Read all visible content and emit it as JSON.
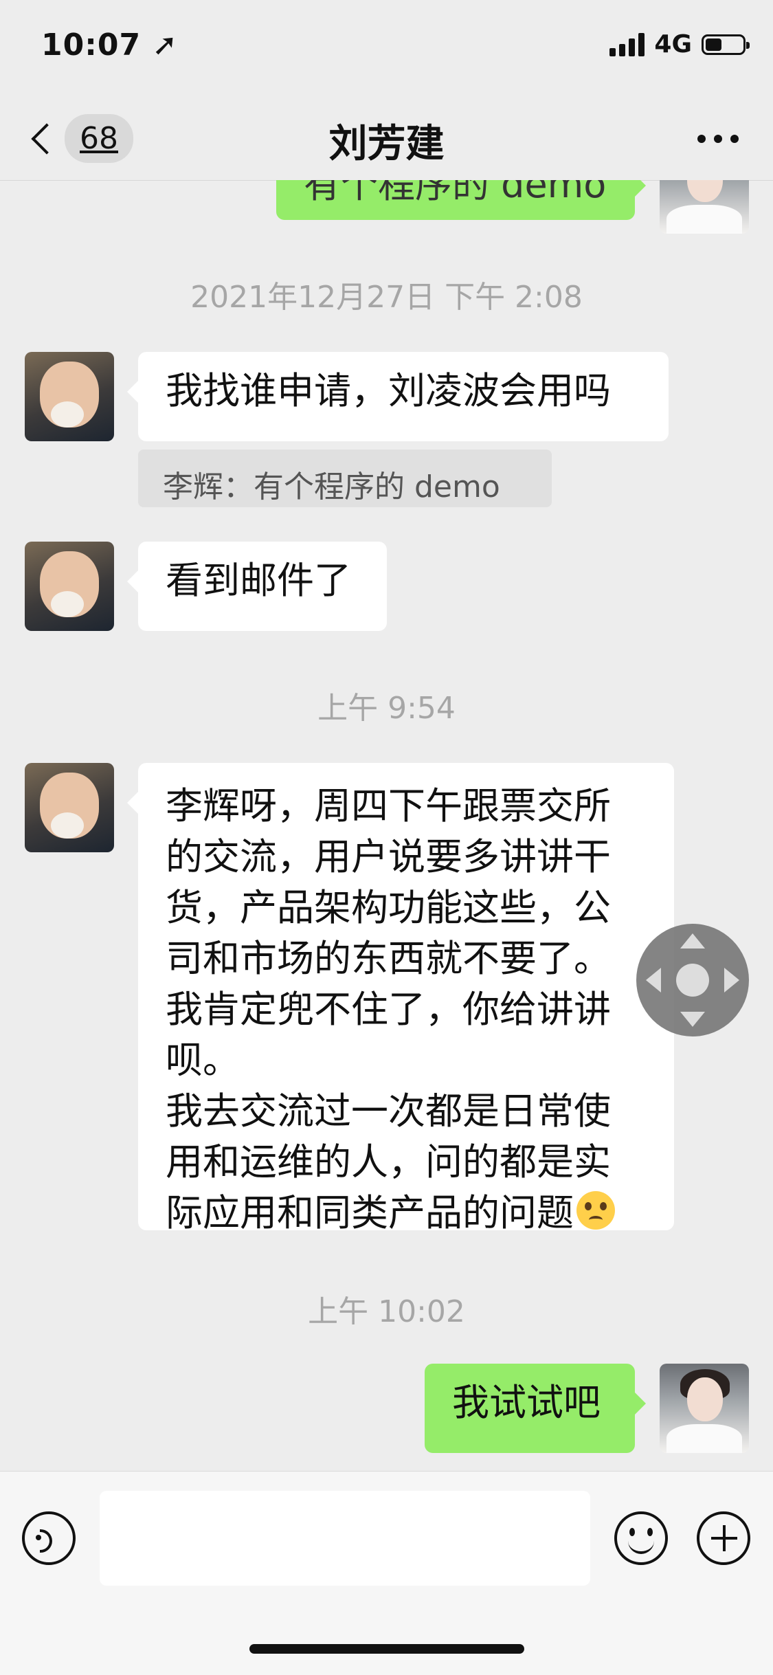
{
  "status_bar": {
    "time": "10:07",
    "network": "4G",
    "battery_level": 0.45
  },
  "nav": {
    "unread_count": "68",
    "title": "刘芳建"
  },
  "messages": {
    "partial_top": "有个程序的 demo",
    "time1": "2021年12月27日 下午 2:08",
    "msg1": "我找谁申请，刘凌波会用吗",
    "quote1": "李辉：有个程序的 demo",
    "msg2": "看到邮件了",
    "time2": "上午 9:54",
    "msg3_lines": [
      "李辉呀，周四下午跟票交所",
      "的交流，用户说要多讲讲干",
      "货，产品架构功能这些，公",
      "司和市场的东西就不要了。",
      "我肯定兜不住了，你给讲讲",
      "呗。",
      "我去交流过一次都是日常使",
      "用和运维的人，问的都是实",
      "际应用和同类产品的问题"
    ],
    "time3": "上午 10:02",
    "msg4": "我试试吧"
  },
  "input_bar": {
    "placeholder": ""
  }
}
